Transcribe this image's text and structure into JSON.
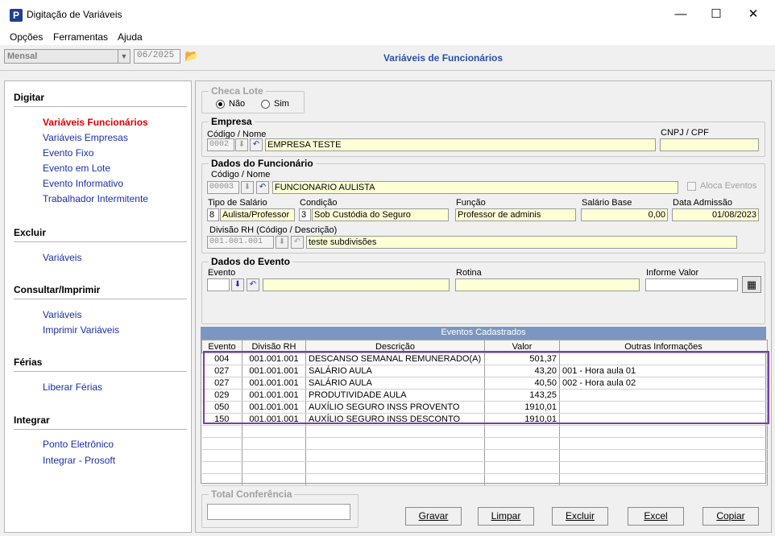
{
  "window": {
    "title": "Digitação de Variáveis",
    "icon_letter": "P"
  },
  "menu": [
    "Opções",
    "Ferramentas",
    "Ajuda"
  ],
  "toolbar": {
    "period_type": "Mensal",
    "competencia": "06/2025"
  },
  "page_title": "Variáveis de Funcionários",
  "sidebar": {
    "sections": [
      {
        "title": "Digitar",
        "items": [
          "Variáveis Funcionários",
          "Variáveis Empresas",
          "Evento Fixo",
          "Evento em Lote",
          "Evento Informativo",
          "Trabalhador Intermitente"
        ]
      },
      {
        "title": "Excluir",
        "items": [
          "Variáveis"
        ]
      },
      {
        "title": "Consultar/Imprimir",
        "items": [
          "Variáveis",
          "Imprimir Variáveis"
        ]
      },
      {
        "title": "Férias",
        "items": [
          "Liberar Férias"
        ]
      },
      {
        "title": "Integrar",
        "items": [
          "Ponto Eletrônico",
          "Integrar - Prosoft"
        ]
      }
    ]
  },
  "checa_lote": {
    "label": "Checa Lote",
    "options": [
      "Não",
      "Sim"
    ],
    "selected": "Não"
  },
  "empresa": {
    "label": "Empresa",
    "code_label": "Código / Nome",
    "code": "0002",
    "name": "EMPRESA TESTE",
    "cnpj_label": "CNPJ / CPF",
    "cnpj": ""
  },
  "funcionario": {
    "label": "Dados do Funcionário",
    "code_label": "Código / Nome",
    "code": "00003",
    "name": "FUNCIONARIO  AULISTA",
    "aloca_label": "Aloca Eventos",
    "tipo_salario_label": "Tipo de Salário",
    "tipo_salario_code": "8",
    "tipo_salario": "Aulista/Professor",
    "condicao_label": "Condição",
    "condicao_code": "3",
    "condicao": "Sob Custódia do Seguro",
    "funcao_label": "Função",
    "funcao": "Professor de adminis",
    "salario_label": "Salário Base",
    "salario": "0,00",
    "admissao_label": "Data Admissão",
    "admissao": "01/08/2023",
    "divisao_label": "Divisão RH (Código / Descrição)",
    "divisao_code": "001.001.001",
    "divisao": "teste subdivisões"
  },
  "evento": {
    "label": "Dados do Evento",
    "evento_label": "Evento",
    "rotina_label": "Rotina",
    "valor_label": "Informe Valor"
  },
  "grid": {
    "title": "Eventos Cadastrados",
    "columns": [
      "Evento",
      "Divisão RH",
      "Descrição",
      "Valor",
      "Outras Informações"
    ],
    "rows": [
      [
        "004",
        "001.001.001",
        "DESCANSO SEMANAL REMUNERADO(A)",
        "501,37",
        ""
      ],
      [
        "027",
        "001.001.001",
        "SALÁRIO AULA",
        "43,20",
        "001 - Hora aula 01"
      ],
      [
        "027",
        "001.001.001",
        "SALÁRIO AULA",
        "40,50",
        "002 - Hora aula 02"
      ],
      [
        "029",
        "001.001.001",
        "PRODUTIVIDADE AULA",
        "143,25",
        ""
      ],
      [
        "050",
        "001.001.001",
        "AUXÍLIO SEGURO  INSS PROVENTO",
        "1910,01",
        ""
      ],
      [
        "150",
        "001.001.001",
        "AUXÍLIO SEGURO  INSS DESCONTO",
        "1910,01",
        ""
      ]
    ],
    "empty_rows": 5
  },
  "total_label": "Total Conferência",
  "buttons": [
    "Gravar",
    "Limpar",
    "Excluir",
    "Excel",
    "Copiar"
  ]
}
